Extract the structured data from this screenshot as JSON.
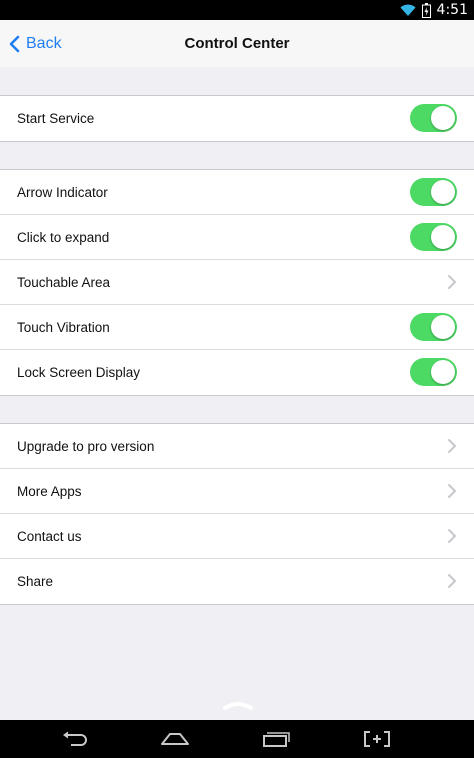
{
  "status_bar": {
    "time": "4:51",
    "icons": [
      "wifi-icon",
      "battery-charging-icon"
    ]
  },
  "nav": {
    "back_label": "Back",
    "title": "Control Center",
    "accent_color": "#1f7ff0"
  },
  "sections": [
    {
      "items": [
        {
          "label": "Start Service",
          "control": "toggle",
          "on": true
        }
      ]
    },
    {
      "items": [
        {
          "label": "Arrow Indicator",
          "control": "toggle",
          "on": true
        },
        {
          "label": "Click to expand",
          "control": "toggle",
          "on": true
        },
        {
          "label": "Touchable Area",
          "control": "chevron"
        },
        {
          "label": "Touch Vibration",
          "control": "toggle",
          "on": true
        },
        {
          "label": "Lock Screen Display",
          "control": "toggle",
          "on": true
        }
      ]
    },
    {
      "items": [
        {
          "label": "Upgrade to pro version",
          "control": "chevron"
        },
        {
          "label": "More Apps",
          "control": "chevron"
        },
        {
          "label": "Contact us",
          "control": "chevron"
        },
        {
          "label": "Share",
          "control": "chevron"
        }
      ]
    }
  ],
  "colors": {
    "toggle_on": "#4cd964",
    "background": "#efeff4"
  },
  "system_nav": {
    "icons": [
      "back-nav-icon",
      "home-nav-icon",
      "recents-nav-icon",
      "screenshot-nav-icon"
    ]
  }
}
